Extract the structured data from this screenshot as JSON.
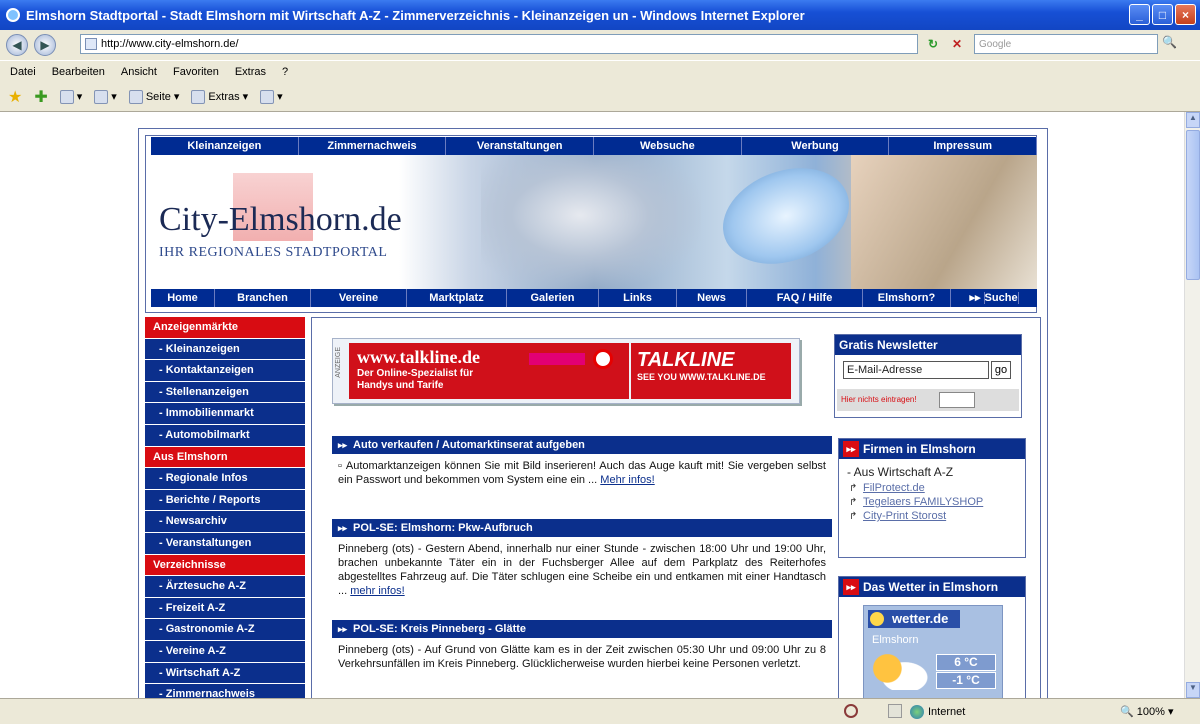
{
  "window": {
    "title": "Elmshorn Stadtportal - Stadt Elmshorn mit Wirtschaft A-Z - Zimmerverzeichnis - Kleinanzeigen un - Windows Internet Explorer"
  },
  "address": {
    "url": "http://www.city-elmshorn.de/",
    "search_placeholder": "Google"
  },
  "menu": [
    "Datei",
    "Bearbeiten",
    "Ansicht",
    "Favoriten",
    "Extras",
    "?"
  ],
  "toolbar": {
    "seite": "Seite",
    "extras": "Extras"
  },
  "status": {
    "zone": "Internet",
    "zoom": "100%"
  },
  "site": {
    "top_nav": [
      "Kleinanzeigen",
      "Zimmernachweis",
      "Veranstaltungen",
      "Websuche",
      "Werbung",
      "Impressum"
    ],
    "logo_title": "City-Elmshorn.de",
    "logo_sub": "IHR REGIONALES STADTPORTAL",
    "sub_nav": [
      "Home",
      "Branchen",
      "Vereine",
      "Marktplatz",
      "Galerien",
      "Links",
      "News",
      "FAQ / Hilfe",
      "Elmshorn?",
      "Suche"
    ],
    "sidebar": [
      {
        "type": "head",
        "label": "Anzeigenmärkte"
      },
      {
        "type": "item",
        "label": "- Kleinanzeigen"
      },
      {
        "type": "item",
        "label": "- Kontaktanzeigen"
      },
      {
        "type": "item",
        "label": "- Stellenanzeigen"
      },
      {
        "type": "item",
        "label": "- Immobilienmarkt"
      },
      {
        "type": "item",
        "label": "- Automobilmarkt"
      },
      {
        "type": "head",
        "label": "Aus Elmshorn"
      },
      {
        "type": "item",
        "label": "- Regionale Infos"
      },
      {
        "type": "item",
        "label": "- Berichte / Reports"
      },
      {
        "type": "item",
        "label": "- Newsarchiv"
      },
      {
        "type": "item",
        "label": "- Veranstaltungen"
      },
      {
        "type": "head",
        "label": "Verzeichnisse"
      },
      {
        "type": "item",
        "label": "- Ärztesuche A-Z"
      },
      {
        "type": "item",
        "label": "- Freizeit A-Z"
      },
      {
        "type": "item",
        "label": "- Gastronomie A-Z"
      },
      {
        "type": "item",
        "label": "- Vereine A-Z"
      },
      {
        "type": "item",
        "label": "- Wirtschaft A-Z"
      },
      {
        "type": "item",
        "label": "- Zimmernachweis"
      }
    ],
    "ad": {
      "label": "ANZEIGE",
      "url": "www.talkline.de",
      "line1": "Der Online-Spezialist für",
      "line2": "Handys und Tarife",
      "brand": "TALKLINE",
      "tagline": "SEE YOU WWW.TALKLINE.DE"
    },
    "news": [
      {
        "title": "Auto verkaufen / Automarktinserat aufgeben",
        "text": "Automarktanzeigen können Sie mit Bild inserieren! Auch das Auge kauft mit! Sie vergeben selbst ein Passwort und bekommen vom System eine ein ...",
        "more": "Mehr infos!"
      },
      {
        "title": "POL-SE: Elmshorn: Pkw-Aufbruch",
        "text": "Pinneberg (ots) - Gestern Abend, innerhalb nur einer Stunde - zwischen 18:00 Uhr und 19:00 Uhr, brachen unbekannte Täter ein in der Fuchsberger Allee auf dem Parkplatz des Reiterhofes abgestelltes Fahrzeug auf. Die Täter schlugen eine Scheibe ein und entkamen mit einer Handtasch ...",
        "more": "mehr infos!"
      },
      {
        "title": "POL-SE: Kreis Pinneberg - Glätte",
        "text": "Pinneberg (ots) - Auf Grund von Glätte kam es in der Zeit zwischen 05:30 Uhr und 09:00 Uhr zu 8 Verkehrsunfällen im Kreis Pinneberg. Glücklicherweise wurden hierbei keine Personen verletzt.",
        "more": ""
      }
    ],
    "newsletter": {
      "title": "Gratis Newsletter",
      "email_value": "E-Mail-Adresse",
      "go": "go",
      "honeypot": "Hier nichts eintragen!"
    },
    "firmen": {
      "title": "Firmen in Elmshorn",
      "subtitle": "- Aus Wirtschaft A-Z",
      "links": [
        "FilProtect.de",
        "Tegelaers FAMILYSHOP",
        "City-Print Storost"
      ]
    },
    "wetter": {
      "title": "Das Wetter in Elmshorn",
      "logo": "wetter.de",
      "city": "Elmshorn",
      "temp_high": "6 °C",
      "temp_low": "-1 °C"
    }
  }
}
